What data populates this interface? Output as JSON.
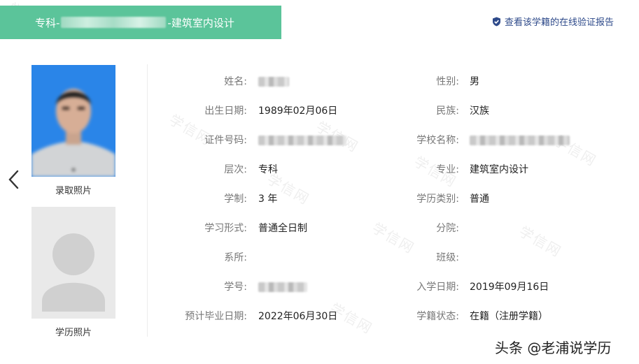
{
  "header": {
    "title_prefix": "专科-",
    "title_suffix": "-建筑室内设计",
    "verify_link": "查看该学籍的在线验证报告"
  },
  "photos": {
    "admission_label": "录取照片",
    "degree_label": "学历照片"
  },
  "fields_left": [
    {
      "label": "姓名:",
      "value": ""
    },
    {
      "label": "出生日期:",
      "value": "1989年02月06日"
    },
    {
      "label": "证件号码:",
      "value": ""
    },
    {
      "label": "层次:",
      "value": "专科"
    },
    {
      "label": "学制:",
      "value": "3 年"
    },
    {
      "label": "学习形式:",
      "value": "普通全日制"
    },
    {
      "label": "系所:",
      "value": ""
    },
    {
      "label": "学号:",
      "value": ""
    },
    {
      "label": "预计毕业日期:",
      "value": "2022年06月30日"
    }
  ],
  "fields_right": [
    {
      "label": "性别:",
      "value": "男"
    },
    {
      "label": "民族:",
      "value": "汉族"
    },
    {
      "label": "学校名称:",
      "value": ""
    },
    {
      "label": "专业:",
      "value": "建筑室内设计"
    },
    {
      "label": "学历类别:",
      "value": "普通"
    },
    {
      "label": "分院:",
      "value": ""
    },
    {
      "label": "班级:",
      "value": ""
    },
    {
      "label": "入学日期:",
      "value": "2019年09月16日"
    },
    {
      "label": "学籍状态:",
      "value": "在籍（注册学籍）"
    }
  ],
  "watermark_text": "学信网",
  "source": "头条 @老浦说学历",
  "colors": {
    "header_bg": "#5bc49a",
    "link": "#2e4a8a",
    "photo_bg": "#2a85e8"
  }
}
